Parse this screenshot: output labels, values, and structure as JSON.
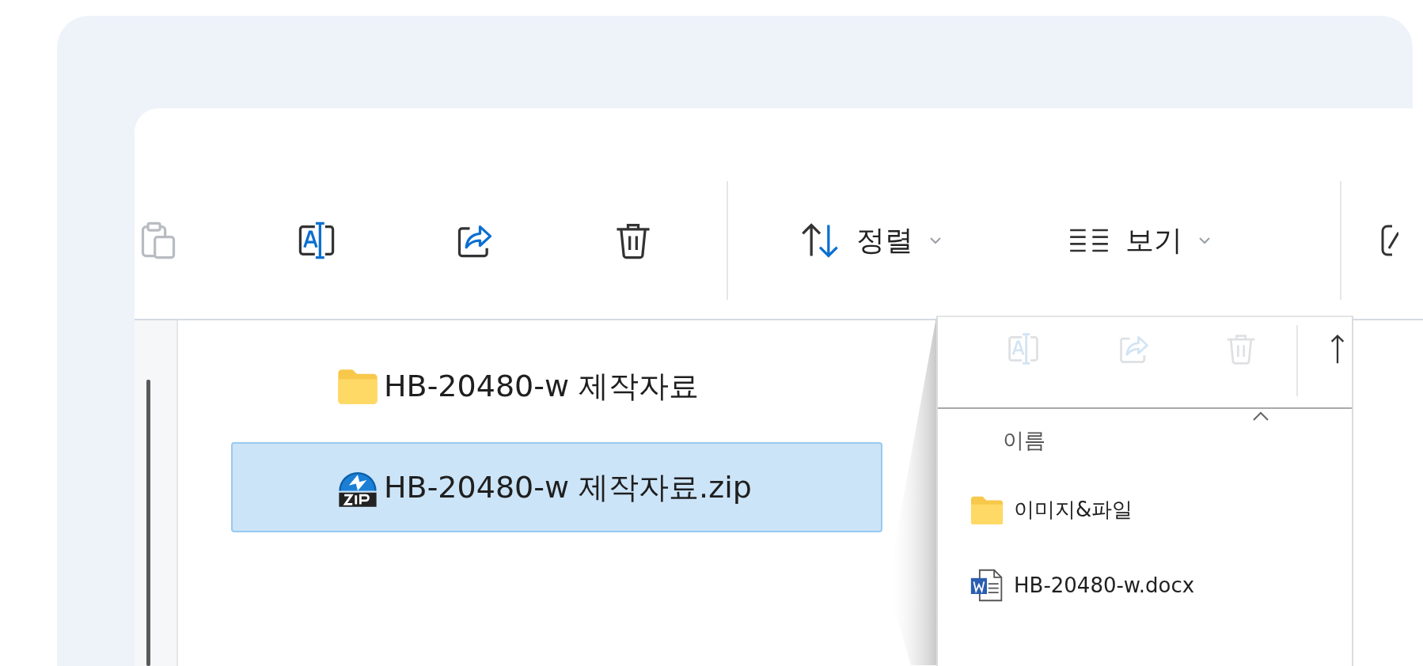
{
  "toolbar": {
    "items": [
      {
        "kind": "paste",
        "disabled": true
      },
      {
        "kind": "rename",
        "disabled": false
      },
      {
        "kind": "share",
        "disabled": false
      },
      {
        "kind": "delete",
        "disabled": false
      },
      {
        "kind": "separator"
      },
      {
        "kind": "sort",
        "label": "정렬"
      },
      {
        "kind": "view",
        "label": "보기"
      },
      {
        "kind": "separator"
      },
      {
        "kind": "partial",
        "disabled": false
      }
    ]
  },
  "files": [
    {
      "kind": "folder",
      "name": "HB-20480-w 제작자료",
      "selected": false
    },
    {
      "kind": "zip",
      "name": "HB-20480-w 제작자료.zip",
      "selected": true
    }
  ],
  "preview": {
    "toolbar": [
      {
        "kind": "rename",
        "disabled": true
      },
      {
        "kind": "share",
        "disabled": true
      },
      {
        "kind": "delete",
        "disabled": true
      },
      {
        "kind": "separator"
      },
      {
        "kind": "up",
        "disabled": false
      }
    ],
    "column_header": "이름",
    "files": [
      {
        "kind": "folder",
        "name": "이미지&파일"
      },
      {
        "kind": "docx",
        "name": "HB-20480-w.docx"
      }
    ]
  }
}
